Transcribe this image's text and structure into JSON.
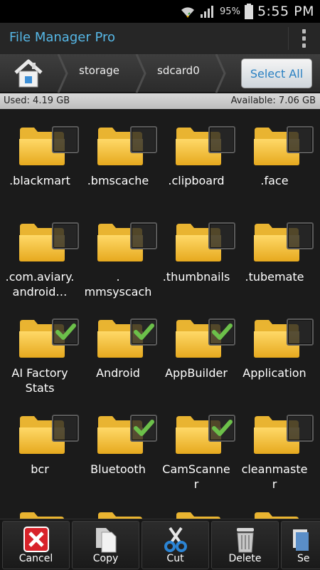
{
  "status": {
    "battery": "95%",
    "time": "5:55 PM"
  },
  "app": {
    "title": "File Manager Pro"
  },
  "breadcrumb": {
    "items": [
      "storage",
      "sdcard0"
    ],
    "select_all": "Select All"
  },
  "storage": {
    "used": "Used: 4.19 GB",
    "available": "Available: 7.06 GB"
  },
  "folders": [
    {
      "name": ".blackmart",
      "checked": false
    },
    {
      "name": ".bmscache",
      "checked": false
    },
    {
      "name": ".clipboard",
      "checked": false
    },
    {
      "name": ".face",
      "checked": false
    },
    {
      "name": ".com.aviary.\nandroid…",
      "checked": false
    },
    {
      "name": ".\nmmsyscach",
      "checked": false
    },
    {
      "name": ".thumbnails",
      "checked": false
    },
    {
      "name": ".tubemate",
      "checked": false
    },
    {
      "name": "AI Factory\nStats",
      "checked": true
    },
    {
      "name": "Android",
      "checked": true
    },
    {
      "name": "AppBuilder",
      "checked": true
    },
    {
      "name": "Application",
      "checked": false
    },
    {
      "name": "bcr",
      "checked": false
    },
    {
      "name": "Bluetooth",
      "checked": true
    },
    {
      "name": "CamScanne\nr",
      "checked": true
    },
    {
      "name": "cleanmaste\nr",
      "checked": false
    }
  ],
  "toolbar": {
    "cancel": "Cancel",
    "copy": "Copy",
    "cut": "Cut",
    "delete": "Delete",
    "send": "Se"
  },
  "colors": {
    "accent": "#56b7e6",
    "folder": "#f4c542",
    "check": "#6cc04a"
  }
}
